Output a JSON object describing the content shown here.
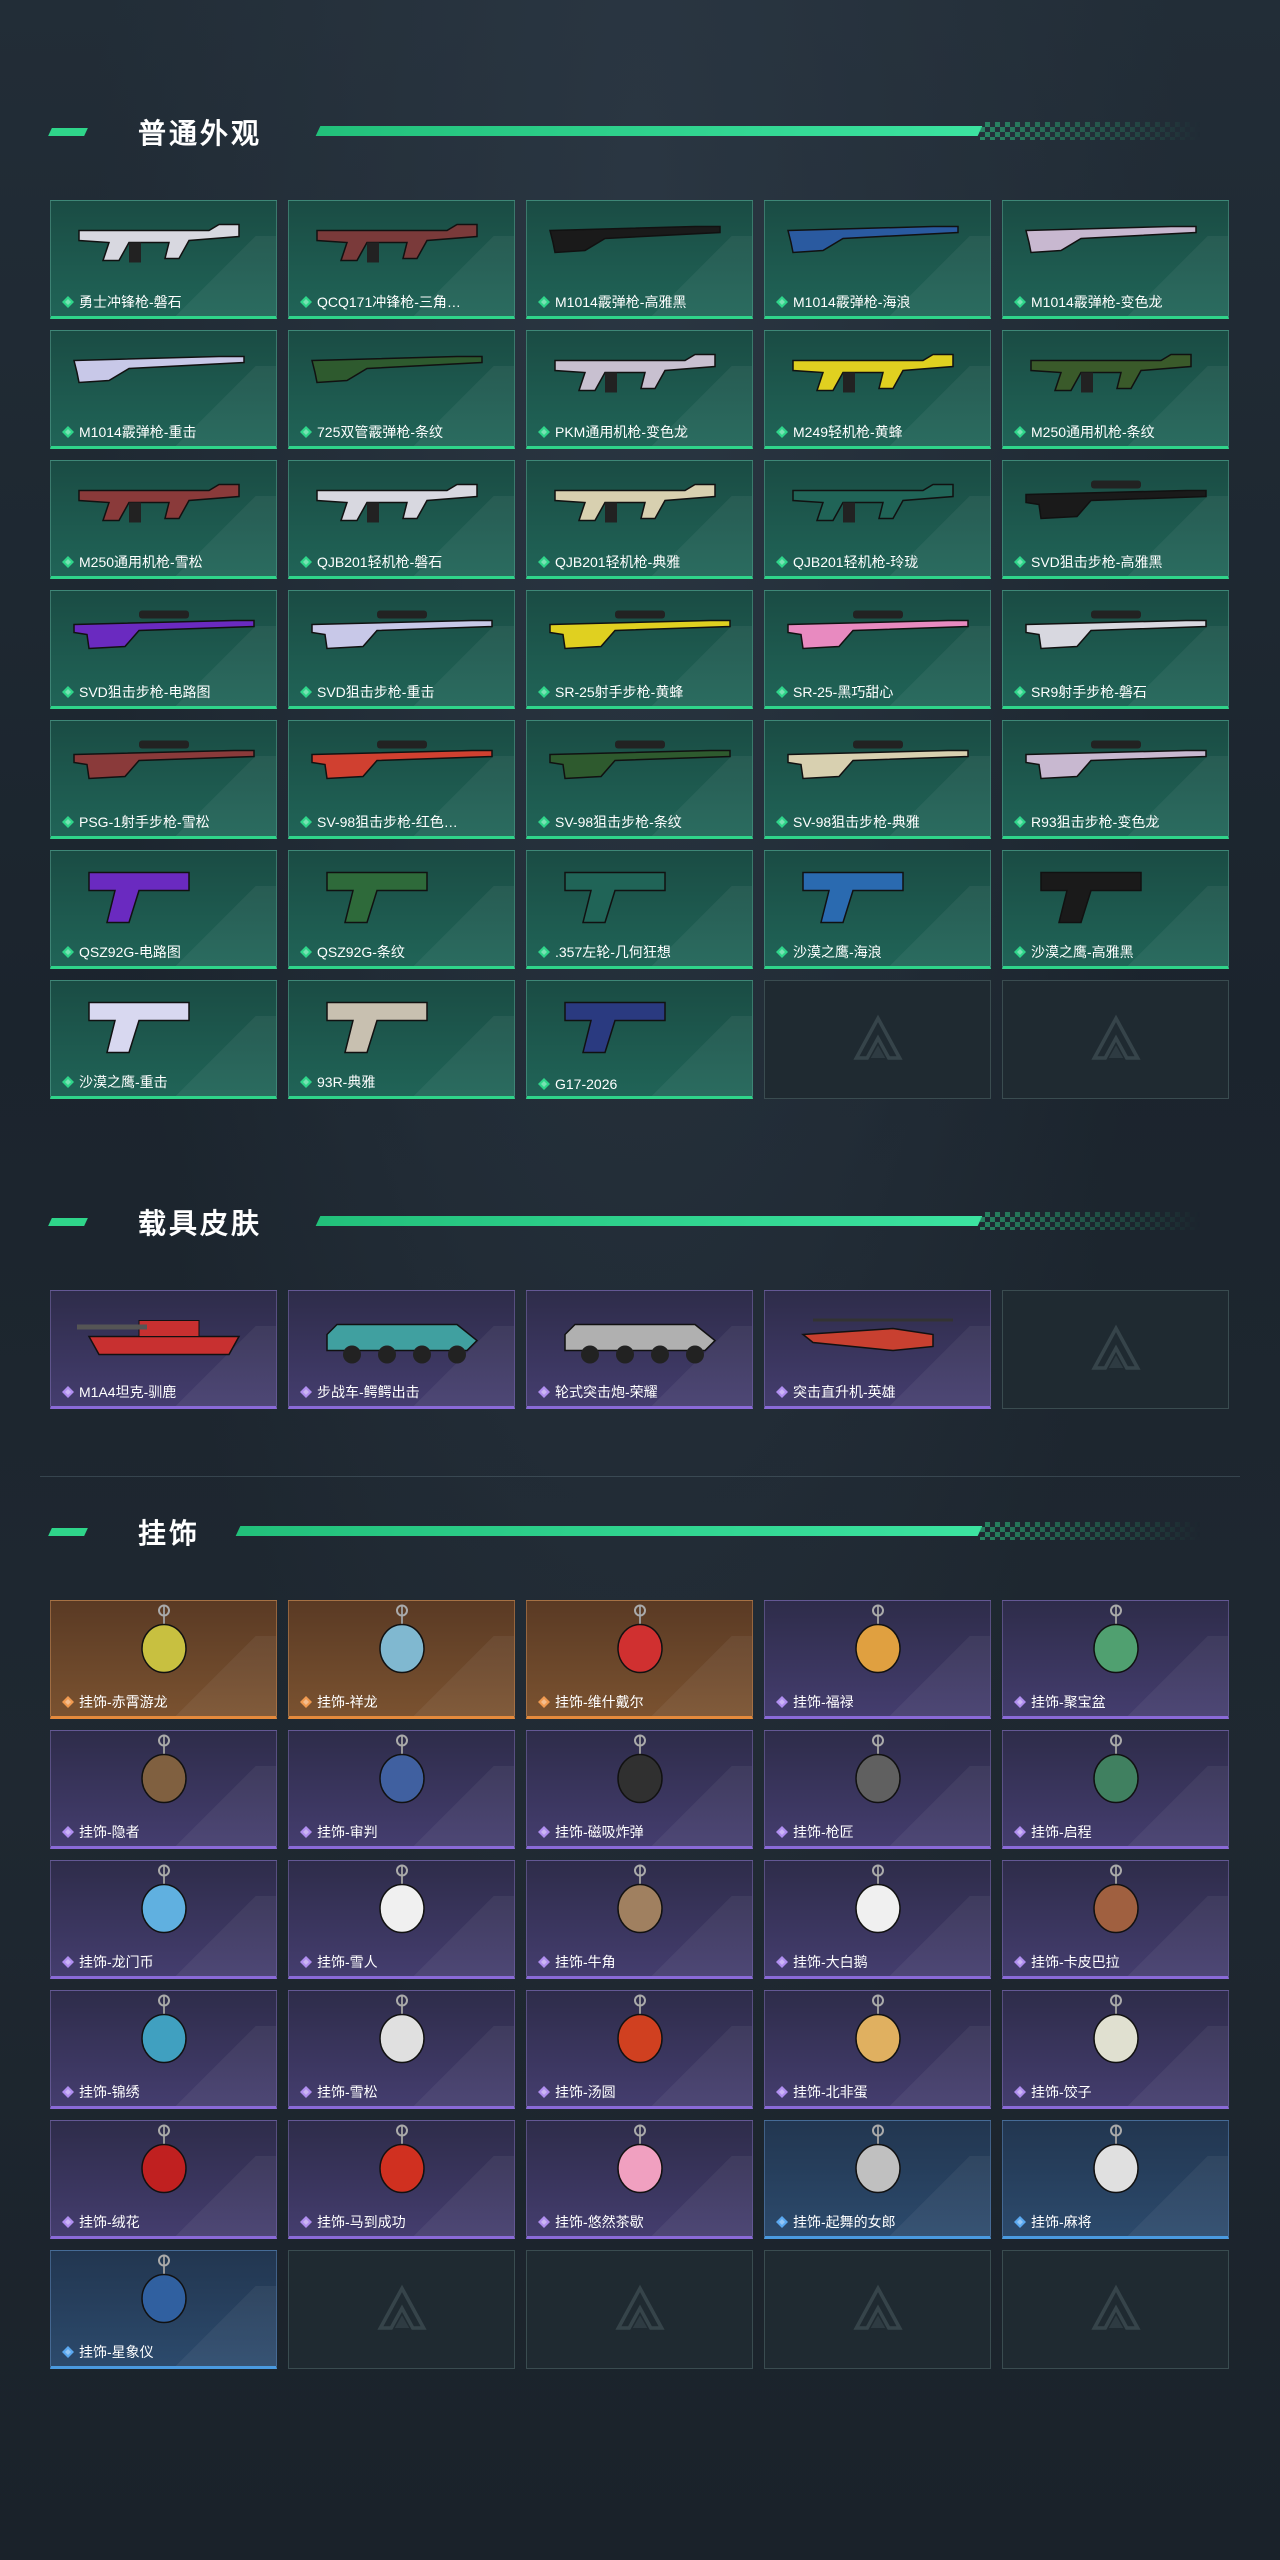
{
  "sections": [
    {
      "title": "普通外观",
      "items": [
        {
          "label": "勇士冲锋枪-磐石",
          "rarity": "green",
          "icon": "smg-icon",
          "color": "#d8d8e0"
        },
        {
          "label": "QCQ171冲锋枪-三角…",
          "rarity": "green",
          "icon": "smg-icon",
          "color": "#7a3a3a"
        },
        {
          "label": "M1014霰弹枪-高雅黑",
          "rarity": "green",
          "icon": "shotgun-icon",
          "color": "#1a1a1a"
        },
        {
          "label": "M1014霰弹枪-海浪",
          "rarity": "green",
          "icon": "shotgun-icon",
          "color": "#2a5aa0"
        },
        {
          "label": "M1014霰弹枪-变色龙",
          "rarity": "green",
          "icon": "shotgun-icon",
          "color": "#c8b8d0"
        },
        {
          "label": "M1014霰弹枪-重击",
          "rarity": "green",
          "icon": "shotgun-icon",
          "color": "#c8c8e8"
        },
        {
          "label": "725双管霰弹枪-条纹",
          "rarity": "green",
          "icon": "shotgun-icon",
          "color": "#2e5a2e"
        },
        {
          "label": "PKM通用机枪-变色龙",
          "rarity": "green",
          "icon": "machine-gun-icon",
          "color": "#c8c0d0"
        },
        {
          "label": "M249轻机枪-黄蜂",
          "rarity": "green",
          "icon": "machine-gun-icon",
          "color": "#e0d020"
        },
        {
          "label": "M250通用机枪-条纹",
          "rarity": "green",
          "icon": "machine-gun-icon",
          "color": "#3a5a2a"
        },
        {
          "label": "M250通用机枪-雪松",
          "rarity": "green",
          "icon": "machine-gun-icon",
          "color": "#8a3a3a"
        },
        {
          "label": "QJB201轻机枪-磐石",
          "rarity": "green",
          "icon": "machine-gun-icon",
          "color": "#d8d8e0"
        },
        {
          "label": "QJB201轻机枪-典雅",
          "rarity": "green",
          "icon": "machine-gun-icon",
          "color": "#d8d0b0"
        },
        {
          "label": "QJB201轻机枪-玲珑",
          "rarity": "green",
          "icon": "machine-gun-icon",
          "color": "#206457"
        },
        {
          "label": "SVD狙击步枪-高雅黑",
          "rarity": "green",
          "icon": "sniper-rifle-icon",
          "color": "#1a1a1a"
        },
        {
          "label": "SVD狙击步枪-电路图",
          "rarity": "green",
          "icon": "sniper-rifle-icon",
          "color": "#6a2ac0"
        },
        {
          "label": "SVD狙击步枪-重击",
          "rarity": "green",
          "icon": "sniper-rifle-icon",
          "color": "#c8c8e8"
        },
        {
          "label": "SR-25射手步枪-黄蜂",
          "rarity": "green",
          "icon": "marksman-rifle-icon",
          "color": "#e0d020"
        },
        {
          "label": "SR-25-黑巧甜心",
          "rarity": "green",
          "icon": "marksman-rifle-icon",
          "color": "#e88ac0"
        },
        {
          "label": "SR9射手步枪-磐石",
          "rarity": "green",
          "icon": "marksman-rifle-icon",
          "color": "#d8d8e0"
        },
        {
          "label": "PSG-1射手步枪-雪松",
          "rarity": "green",
          "icon": "marksman-rifle-icon",
          "color": "#8a3a3a"
        },
        {
          "label": "SV-98狙击步枪-红色…",
          "rarity": "green",
          "icon": "sniper-rifle-icon",
          "color": "#d04030"
        },
        {
          "label": "SV-98狙击步枪-条纹",
          "rarity": "green",
          "icon": "sniper-rifle-icon",
          "color": "#2e5a2e"
        },
        {
          "label": "SV-98狙击步枪-典雅",
          "rarity": "green",
          "icon": "sniper-rifle-icon",
          "color": "#d8d0b0"
        },
        {
          "label": "R93狙击步枪-变色龙",
          "rarity": "green",
          "icon": "sniper-rifle-icon",
          "color": "#c8b8d0"
        },
        {
          "label": "QSZ92G-电路图",
          "rarity": "green",
          "icon": "pistol-icon",
          "color": "#6a2ac0"
        },
        {
          "label": "QSZ92G-条纹",
          "rarity": "green",
          "icon": "pistol-icon",
          "color": "#2e6a3a"
        },
        {
          "label": ".357左轮-几何狂想",
          "rarity": "green",
          "icon": "revolver-icon",
          "color": "#206457"
        },
        {
          "label": "沙漠之鹰-海浪",
          "rarity": "green",
          "icon": "pistol-icon",
          "color": "#2a6ab0"
        },
        {
          "label": "沙漠之鹰-高雅黑",
          "rarity": "green",
          "icon": "pistol-icon",
          "color": "#1a1a1a"
        },
        {
          "label": "沙漠之鹰-重击",
          "rarity": "green",
          "icon": "pistol-icon",
          "color": "#d8d8f0"
        },
        {
          "label": "93R-典雅",
          "rarity": "green",
          "icon": "pistol-icon",
          "color": "#c8c0b0"
        },
        {
          "label": "G17-2026",
          "rarity": "green",
          "icon": "pistol-icon",
          "color": "#2a3a80"
        },
        {
          "label": "",
          "rarity": "empty",
          "icon": "logo-watermark-icon",
          "color": ""
        },
        {
          "label": "",
          "rarity": "empty",
          "icon": "logo-watermark-icon",
          "color": ""
        }
      ]
    },
    {
      "title": "载具皮肤",
      "items": [
        {
          "label": "M1A4坦克-驯鹿",
          "rarity": "purple",
          "icon": "tank-icon",
          "color": "#c83030"
        },
        {
          "label": "步战车-鳄鳄出击",
          "rarity": "purple",
          "icon": "ifv-icon",
          "color": "#40a0a0"
        },
        {
          "label": "轮式突击炮-荣耀",
          "rarity": "purple",
          "icon": "assault-vehicle-icon",
          "color": "#b0b0b0"
        },
        {
          "label": "突击直升机-英雄",
          "rarity": "purple",
          "icon": "helicopter-icon",
          "color": "#c84030"
        },
        {
          "label": "",
          "rarity": "empty",
          "icon": "logo-watermark-icon",
          "color": ""
        }
      ]
    },
    {
      "title": "挂饰",
      "items": [
        {
          "label": "挂饰-赤霄游龙",
          "rarity": "orange",
          "icon": "charm-icon",
          "color": "#c8c040"
        },
        {
          "label": "挂饰-祥龙",
          "rarity": "orange",
          "icon": "charm-icon",
          "color": "#80b8d0"
        },
        {
          "label": "挂饰-维什戴尔",
          "rarity": "orange",
          "icon": "charm-icon",
          "color": "#d03030"
        },
        {
          "label": "挂饰-福禄",
          "rarity": "purple",
          "icon": "charm-icon",
          "color": "#e0a040"
        },
        {
          "label": "挂饰-聚宝盆",
          "rarity": "purple",
          "icon": "charm-icon",
          "color": "#50a070"
        },
        {
          "label": "挂饰-隐者",
          "rarity": "purple",
          "icon": "charm-icon",
          "color": "#806040"
        },
        {
          "label": "挂饰-审判",
          "rarity": "purple",
          "icon": "charm-icon",
          "color": "#4060a0"
        },
        {
          "label": "挂饰-磁吸炸弹",
          "rarity": "purple",
          "icon": "charm-icon",
          "color": "#303030"
        },
        {
          "label": "挂饰-枪匠",
          "rarity": "purple",
          "icon": "charm-icon",
          "color": "#606060"
        },
        {
          "label": "挂饰-启程",
          "rarity": "purple",
          "icon": "charm-icon",
          "color": "#408060"
        },
        {
          "label": "挂饰-龙门币",
          "rarity": "purple",
          "icon": "charm-icon",
          "color": "#60b0e0"
        },
        {
          "label": "挂饰-雪人",
          "rarity": "purple",
          "icon": "charm-icon",
          "color": "#f0f0f0"
        },
        {
          "label": "挂饰-牛角",
          "rarity": "purple",
          "icon": "charm-icon",
          "color": "#a08060"
        },
        {
          "label": "挂饰-大白鹅",
          "rarity": "purple",
          "icon": "charm-icon",
          "color": "#f0f0f0"
        },
        {
          "label": "挂饰-卡皮巴拉",
          "rarity": "purple",
          "icon": "charm-icon",
          "color": "#a06040"
        },
        {
          "label": "挂饰-锦绣",
          "rarity": "purple",
          "icon": "charm-icon",
          "color": "#40a0c0"
        },
        {
          "label": "挂饰-雪松",
          "rarity": "purple",
          "icon": "charm-icon",
          "color": "#e0e0e0"
        },
        {
          "label": "挂饰-汤圆",
          "rarity": "purple",
          "icon": "charm-icon",
          "color": "#d04020"
        },
        {
          "label": "挂饰-北非蛋",
          "rarity": "purple",
          "icon": "charm-icon",
          "color": "#e0b060"
        },
        {
          "label": "挂饰-饺子",
          "rarity": "purple",
          "icon": "charm-icon",
          "color": "#e0e0d0"
        },
        {
          "label": "挂饰-绒花",
          "rarity": "purple",
          "icon": "charm-icon",
          "color": "#c02020"
        },
        {
          "label": "挂饰-马到成功",
          "rarity": "purple",
          "icon": "charm-icon",
          "color": "#d03020"
        },
        {
          "label": "挂饰-悠然茶歇",
          "rarity": "purple",
          "icon": "charm-icon",
          "color": "#f0a0c0"
        },
        {
          "label": "挂饰-起舞的女郎",
          "rarity": "blue",
          "icon": "charm-icon",
          "color": "#c0c0c0"
        },
        {
          "label": "挂饰-麻将",
          "rarity": "blue",
          "icon": "charm-icon",
          "color": "#e0e0e0"
        },
        {
          "label": "挂饰-星象仪",
          "rarity": "blue",
          "icon": "charm-icon",
          "color": "#3060a0"
        },
        {
          "label": "",
          "rarity": "empty",
          "icon": "logo-watermark-icon",
          "color": ""
        },
        {
          "label": "",
          "rarity": "empty",
          "icon": "logo-watermark-icon",
          "color": ""
        },
        {
          "label": "",
          "rarity": "empty",
          "icon": "logo-watermark-icon",
          "color": ""
        },
        {
          "label": "",
          "rarity": "empty",
          "icon": "logo-watermark-icon",
          "color": ""
        }
      ]
    }
  ],
  "colors": {
    "accent": "#2fd58a",
    "green_card": "#206457",
    "purple_card": "#443d6e",
    "orange_card": "#7a5230",
    "blue_card": "#2c4a6c",
    "background": "#1e2730"
  }
}
